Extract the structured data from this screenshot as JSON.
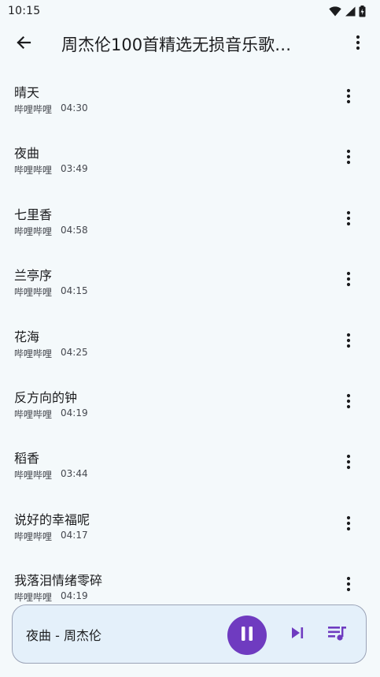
{
  "status_bar": {
    "time": "10:15",
    "icons": [
      "wifi-icon",
      "cellular-icon",
      "battery-icon"
    ]
  },
  "app_bar": {
    "back_icon": "arrow-back-icon",
    "title": "周杰伦100首精选无损音乐歌…",
    "overflow_icon": "more-vert-icon"
  },
  "songs": [
    {
      "title": "晴天",
      "source": "哔哩哔哩",
      "duration": "04:30"
    },
    {
      "title": "夜曲",
      "source": "哔哩哔哩",
      "duration": "03:49"
    },
    {
      "title": "七里香",
      "source": "哔哩哔哩",
      "duration": "04:58"
    },
    {
      "title": "兰亭序",
      "source": "哔哩哔哩",
      "duration": "04:15"
    },
    {
      "title": "花海",
      "source": "哔哩哔哩",
      "duration": "04:25"
    },
    {
      "title": "反方向的钟",
      "source": "哔哩哔哩",
      "duration": "04:19"
    },
    {
      "title": "稻香",
      "source": "哔哩哔哩",
      "duration": "03:44"
    },
    {
      "title": "说好的幸福呢",
      "source": "哔哩哔哩",
      "duration": "04:17"
    },
    {
      "title": "我落泪情绪零碎",
      "source": "哔哩哔哩",
      "duration": "04:19"
    }
  ],
  "mini_player": {
    "now_playing": "夜曲 - 周杰伦",
    "play_state_icon": "pause-icon",
    "next_icon": "skip-next-icon",
    "queue_icon": "queue-music-icon"
  },
  "colors": {
    "background": "#f4f9fb",
    "accent": "#6f3bc0",
    "player_background": "#e4f0fa",
    "text_primary": "#1b1c1e",
    "text_secondary": "#44474e"
  }
}
